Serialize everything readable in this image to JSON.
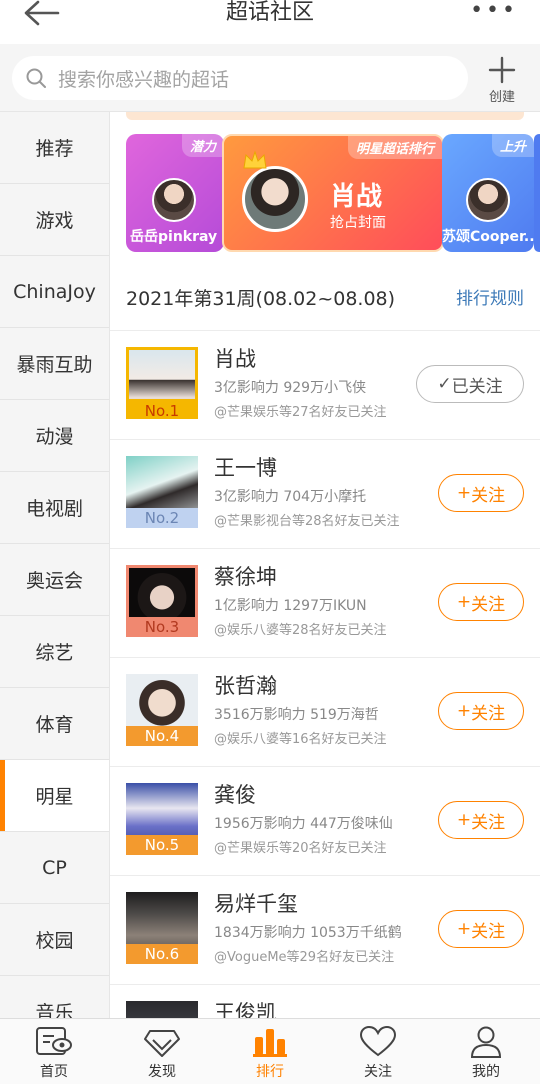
{
  "header": {
    "title": "超话社区"
  },
  "search": {
    "placeholder": "搜索你感兴趣的超话",
    "create_label": "创建"
  },
  "sidebar": {
    "items": [
      {
        "label": "推荐"
      },
      {
        "label": "游戏"
      },
      {
        "label": "ChinaJoy"
      },
      {
        "label": "暴雨互助"
      },
      {
        "label": "动漫"
      },
      {
        "label": "电视剧"
      },
      {
        "label": "奥运会"
      },
      {
        "label": "综艺"
      },
      {
        "label": "体育"
      },
      {
        "label": "明星"
      },
      {
        "label": "CP"
      },
      {
        "label": "校园"
      },
      {
        "label": "音乐"
      }
    ],
    "active": "明星"
  },
  "banner": {
    "left": {
      "tag": "潜力",
      "name": "岳岳pinkray"
    },
    "mid": {
      "tag": "明星超话排行",
      "name": "肖战",
      "sub": "抢占封面"
    },
    "right": {
      "tag": "上升",
      "name": "苏颂Cooper..."
    }
  },
  "week": {
    "label": "2021年第31周(08.02~08.08)",
    "rule_link": "排行规则"
  },
  "list": [
    {
      "rank": "No.1",
      "name": "肖战",
      "stats": "3亿影响力 929万小飞侠",
      "friends": "@芒果娱乐等27名好友已关注",
      "button": "已关注",
      "followed": true
    },
    {
      "rank": "No.2",
      "name": "王一博",
      "stats": "3亿影响力 704万小摩托",
      "friends": "@芒果影视台等28名好友已关注",
      "button": "关注",
      "followed": false
    },
    {
      "rank": "No.3",
      "name": "蔡徐坤",
      "stats": "1亿影响力 1297万IKUN",
      "friends": "@娱乐八婆等28名好友已关注",
      "button": "关注",
      "followed": false
    },
    {
      "rank": "No.4",
      "name": "张哲瀚",
      "stats": "3516万影响力 519万海哲",
      "friends": "@娱乐八婆等16名好友已关注",
      "button": "关注",
      "followed": false
    },
    {
      "rank": "No.5",
      "name": "龚俊",
      "stats": "1956万影响力 447万俊味仙",
      "friends": "@芒果娱乐等20名好友已关注",
      "button": "关注",
      "followed": false
    },
    {
      "rank": "No.6",
      "name": "易烊千玺",
      "stats": "1834万影响力 1053万千纸鹤",
      "friends": "@VogueMe等29名好友已关注",
      "button": "关注",
      "followed": false
    },
    {
      "rank": "",
      "name": "王俊凯",
      "stats": "",
      "friends": "",
      "button": "",
      "followed": false
    }
  ],
  "tabbar": [
    {
      "label": "首页"
    },
    {
      "label": "发现"
    },
    {
      "label": "排行"
    },
    {
      "label": "关注"
    },
    {
      "label": "我的"
    }
  ],
  "colors": {
    "accent": "#ff8200",
    "link": "#3d7ab8"
  }
}
